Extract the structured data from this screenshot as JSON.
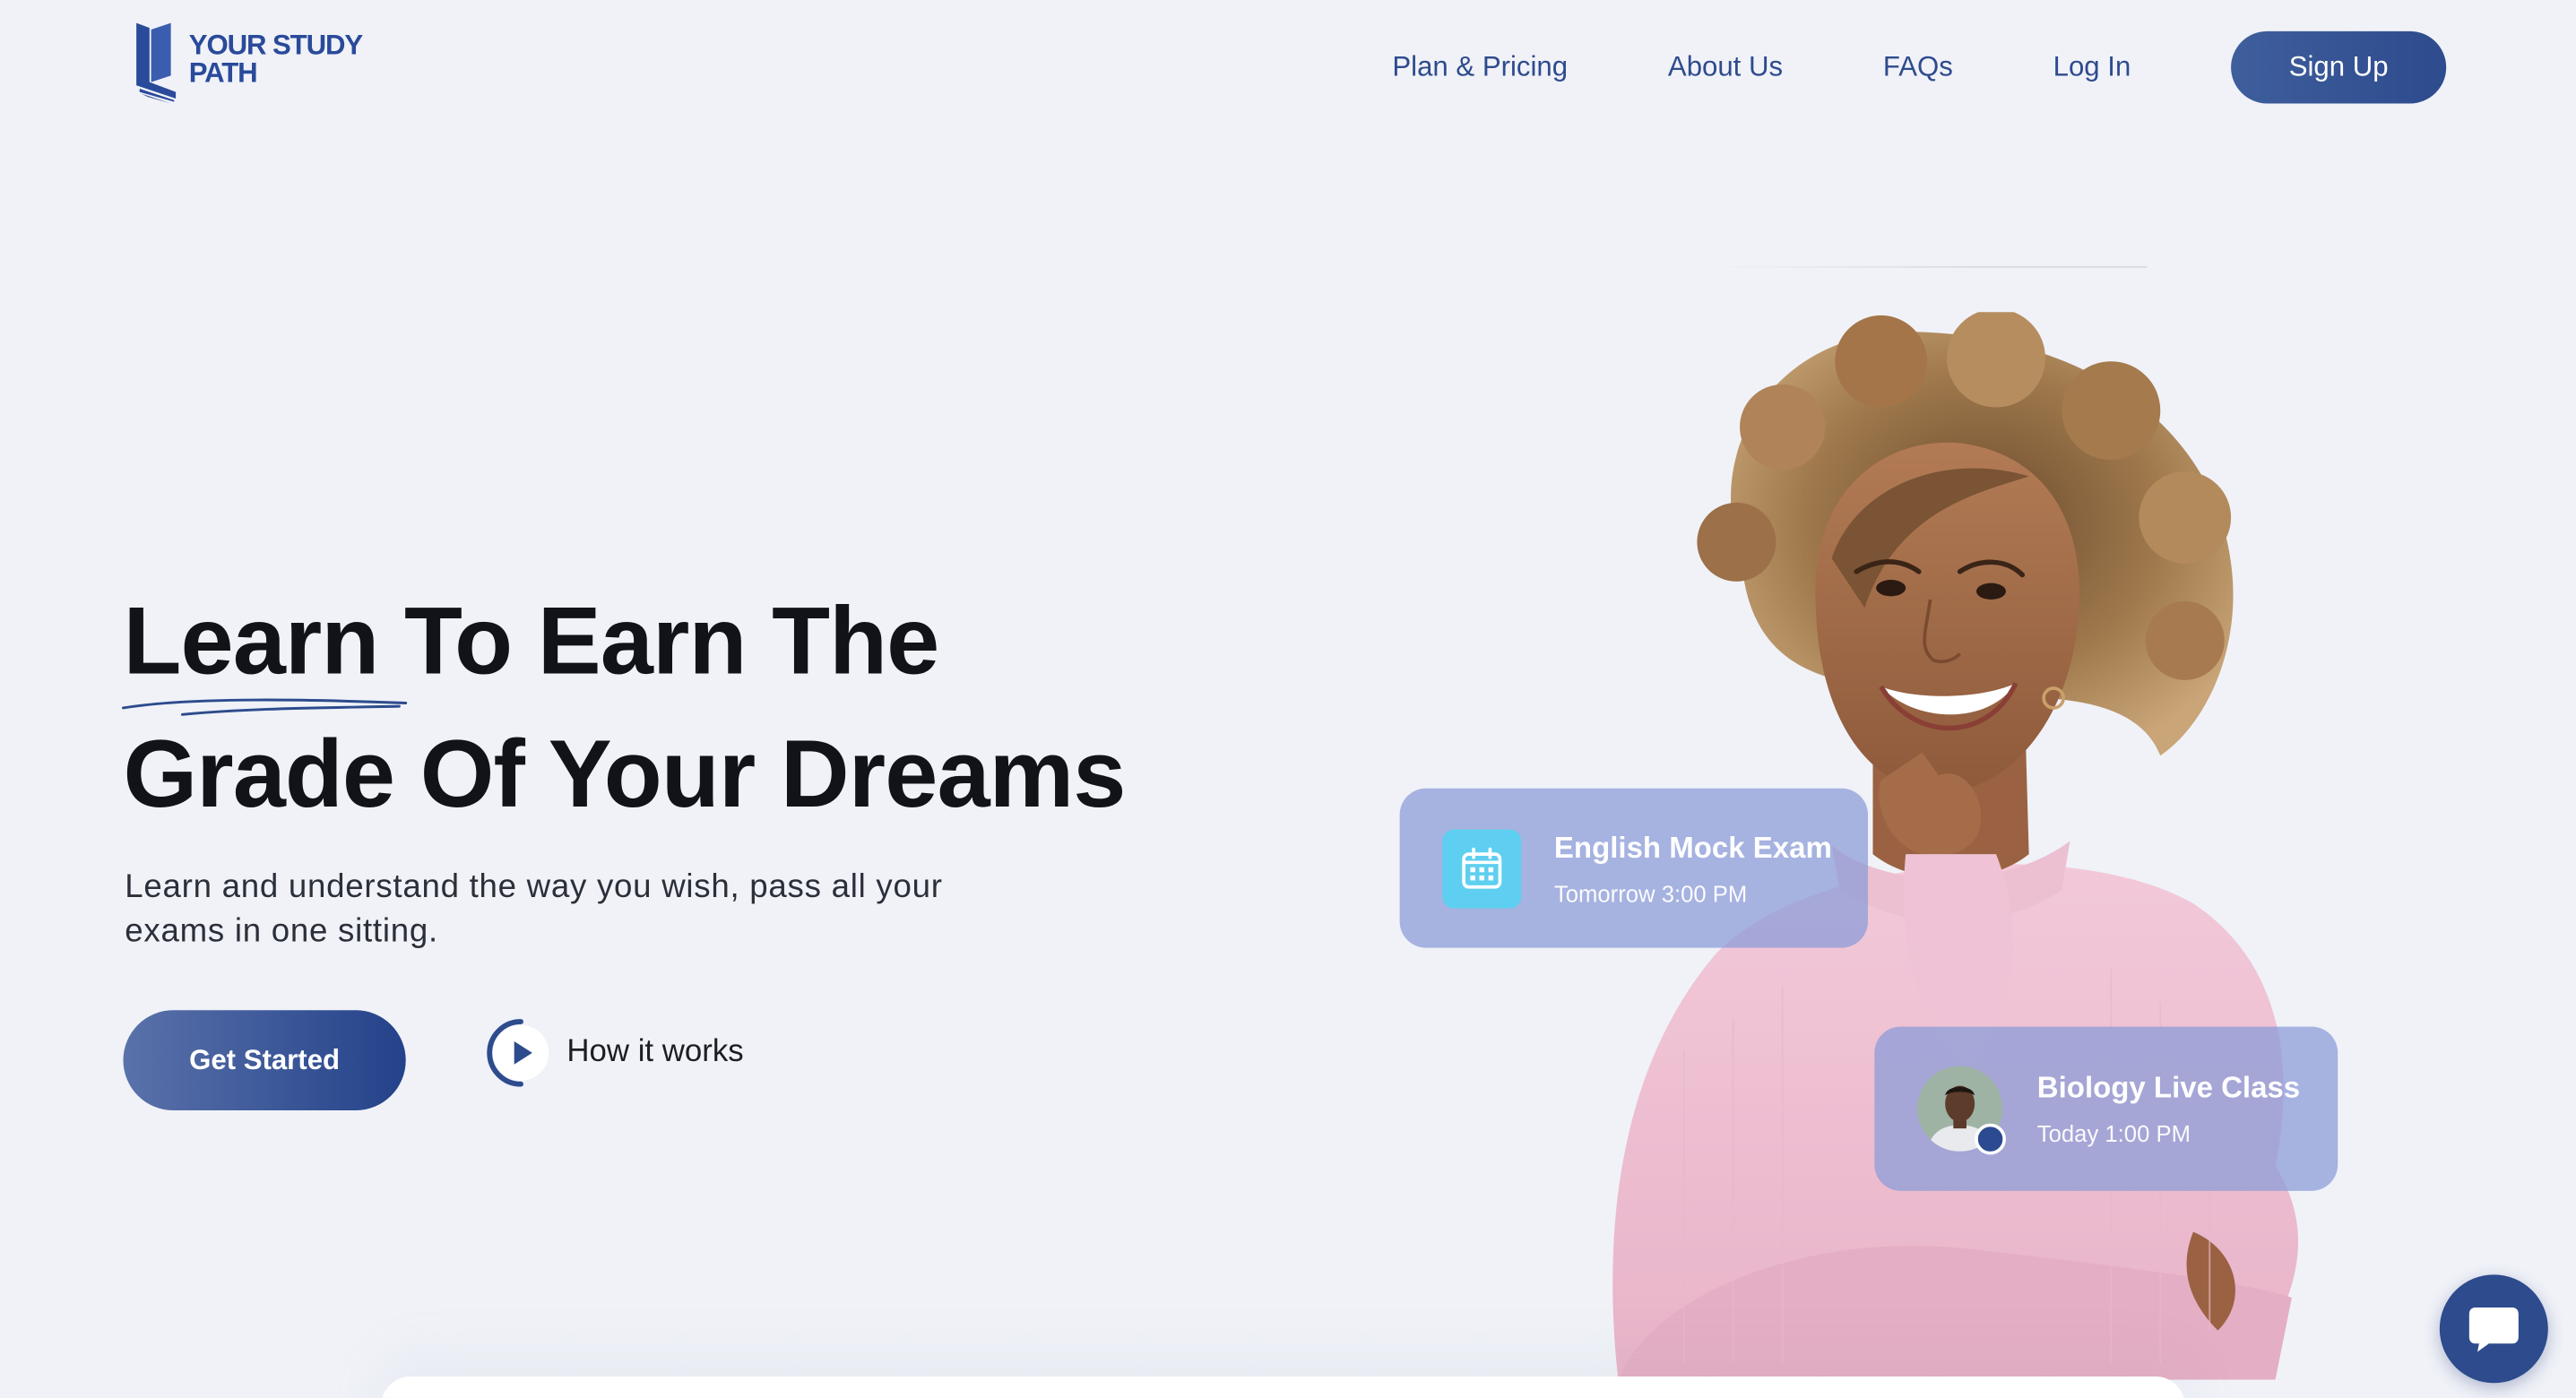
{
  "brand": {
    "line1": "YOUR STUDY",
    "line2": "PATH"
  },
  "nav": {
    "links": [
      "Plan & Pricing",
      "About Us",
      "FAQs",
      "Log In"
    ],
    "signup_label": "Sign Up"
  },
  "hero": {
    "title_underlined": "Learn",
    "title_line1_rest": " To Earn The",
    "title_line2": "Grade Of Your Dreams",
    "subtitle": "Learn and understand the way you wish, pass all your exams in one sitting.",
    "cta_label": "Get Started",
    "how_label": "How it works"
  },
  "cards": {
    "exam": {
      "title": "English Mock Exam",
      "time": "Tomorrow 3:00 PM"
    },
    "class": {
      "title": "Biology Live Class",
      "time": "Today 1:00 PM"
    }
  },
  "icons": {
    "logo": "book-path-logo",
    "play": "play-icon",
    "calendar": "calendar-icon",
    "avatar": "teacher-avatar",
    "chat": "chat-icon"
  },
  "colors": {
    "brand_blue": "#2d4b8d",
    "background": "#f0f2f8",
    "card_overlay": "#8e9ed8",
    "calendar_tile": "#5ecff0"
  }
}
